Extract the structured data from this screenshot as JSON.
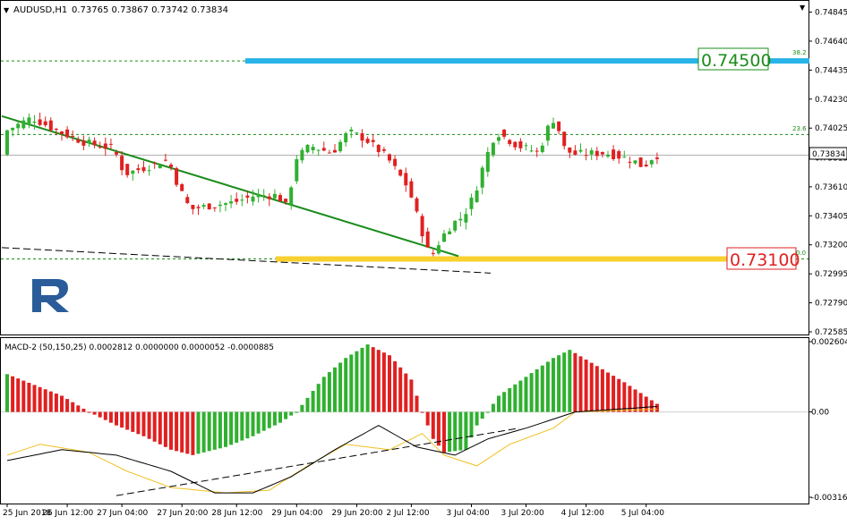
{
  "header": {
    "symbol": "AUDUSD,H1",
    "ohlc": "0.73765 0.73867 0.73742 0.73834"
  },
  "macd": {
    "label": "MACD-2 (50,150,25) 0.0002812 0.0000000 0.0000052 -0.0000885",
    "ticks": [
      "0.002604",
      "0.00",
      "-0.003162"
    ]
  },
  "levels": {
    "resistance": "0.74500",
    "support": "0.73100",
    "fib_38": "38.2",
    "fib_23": "23.6",
    "fib_00": "0.0"
  },
  "current_price": "0.73834",
  "colors": {
    "bull": "#30b030",
    "bear": "#e02020",
    "trend": "#1a8c1a",
    "resistance_band": "#28b4e8",
    "support_band": "#f8d030",
    "resistance_label": "#1a8c1a",
    "support_label": "#e02020",
    "signal_line": "#f0c020",
    "macd_line": "#000000"
  },
  "chart_data": {
    "type": "candlestick",
    "symbol": "AUDUSD",
    "timeframe": "H1",
    "price_ticks": [
      "0.74845",
      "0.74640",
      "0.74435",
      "0.74230",
      "0.74025",
      "0.73815",
      "0.73610",
      "0.73405",
      "0.73200",
      "0.72995",
      "0.72790",
      "0.72585"
    ],
    "price_range": [
      0.72585,
      0.7488
    ],
    "x_ticks": [
      "25 Jun 2018",
      "26 Jun 12:00",
      "27 Jun 04:00",
      "27 Jun 20:00",
      "28 Jun 12:00",
      "29 Jun 04:00",
      "29 Jun 20:00",
      "2 Jul 12:00",
      "3 Jul 04:00",
      "3 Jul 20:00",
      "4 Jul 12:00",
      "5 Jul 04:00"
    ],
    "bar_count": 120,
    "resistance": 0.745,
    "support": 0.731,
    "fib_level_38_2": 0.745,
    "fib_level_23_6": 0.7398,
    "fib_level_0": 0.731,
    "last_price": 0.73834,
    "keypoints": [
      [
        0,
        0.74
      ],
      [
        5,
        0.741
      ],
      [
        10,
        0.74
      ],
      [
        15,
        0.7392
      ],
      [
        20,
        0.7388
      ],
      [
        22,
        0.737
      ],
      [
        26,
        0.7375
      ],
      [
        30,
        0.738
      ],
      [
        32,
        0.736
      ],
      [
        34,
        0.7345
      ],
      [
        38,
        0.7348
      ],
      [
        42,
        0.735
      ],
      [
        46,
        0.7355
      ],
      [
        50,
        0.7355
      ],
      [
        52,
        0.7345
      ],
      [
        53,
        0.738
      ],
      [
        56,
        0.739
      ],
      [
        60,
        0.7385
      ],
      [
        63,
        0.74
      ],
      [
        66,
        0.7395
      ],
      [
        70,
        0.7382
      ],
      [
        74,
        0.736
      ],
      [
        76,
        0.7335
      ],
      [
        78,
        0.731
      ],
      [
        80,
        0.7325
      ],
      [
        82,
        0.7335
      ],
      [
        84,
        0.734
      ],
      [
        86,
        0.7355
      ],
      [
        88,
        0.738
      ],
      [
        90,
        0.74
      ],
      [
        94,
        0.739
      ],
      [
        98,
        0.7385
      ],
      [
        99,
        0.74
      ],
      [
        100,
        0.7405
      ],
      [
        101,
        0.7412
      ],
      [
        102,
        0.739
      ],
      [
        104,
        0.7384
      ],
      [
        110,
        0.7385
      ],
      [
        115,
        0.738
      ],
      [
        117,
        0.7375
      ],
      [
        119,
        0.73834
      ]
    ],
    "macd_range": [
      -0.003162,
      0.002604
    ],
    "macd_histogram_keypoints": [
      [
        0,
        0.0014
      ],
      [
        10,
        0.0006
      ],
      [
        15,
        0.0
      ],
      [
        20,
        -0.0005
      ],
      [
        25,
        -0.0009
      ],
      [
        30,
        -0.0014
      ],
      [
        34,
        -0.0016
      ],
      [
        40,
        -0.0013
      ],
      [
        45,
        -0.0009
      ],
      [
        50,
        -0.0004
      ],
      [
        53,
        0.0
      ],
      [
        58,
        0.0013
      ],
      [
        62,
        0.002
      ],
      [
        66,
        0.0025
      ],
      [
        70,
        0.0021
      ],
      [
        74,
        0.0012
      ],
      [
        76,
        0.0
      ],
      [
        78,
        -0.001
      ],
      [
        80,
        -0.0015
      ],
      [
        84,
        -0.0014
      ],
      [
        86,
        -0.0005
      ],
      [
        88,
        0.0
      ],
      [
        90,
        0.0006
      ],
      [
        95,
        0.0013
      ],
      [
        100,
        0.002
      ],
      [
        103,
        0.0023
      ],
      [
        108,
        0.0017
      ],
      [
        113,
        0.0011
      ],
      [
        119,
        0.0003
      ]
    ],
    "macd_line_keypoints": [
      [
        0,
        -0.0018
      ],
      [
        10,
        -0.0014
      ],
      [
        20,
        -0.0016
      ],
      [
        30,
        -0.0022
      ],
      [
        38,
        -0.003
      ],
      [
        45,
        -0.003
      ],
      [
        52,
        -0.0024
      ],
      [
        60,
        -0.0014
      ],
      [
        68,
        -0.0005
      ],
      [
        75,
        -0.0013
      ],
      [
        82,
        -0.0016
      ],
      [
        88,
        -0.001
      ],
      [
        95,
        -0.0006
      ],
      [
        104,
        0.0
      ],
      [
        119,
        0.0002
      ]
    ],
    "signal_line_keypoints": [
      [
        0,
        -0.0016
      ],
      [
        6,
        -0.0012
      ],
      [
        15,
        -0.0015
      ],
      [
        22,
        -0.0022
      ],
      [
        30,
        -0.0028
      ],
      [
        40,
        -0.003
      ],
      [
        48,
        -0.0029
      ],
      [
        55,
        -0.002
      ],
      [
        62,
        -0.0012
      ],
      [
        70,
        -0.0014
      ],
      [
        76,
        -0.0008
      ],
      [
        80,
        -0.0016
      ],
      [
        86,
        -0.002
      ],
      [
        92,
        -0.0012
      ],
      [
        100,
        -0.0006
      ],
      [
        104,
        0.0
      ],
      [
        119,
        0.0001
      ]
    ]
  }
}
